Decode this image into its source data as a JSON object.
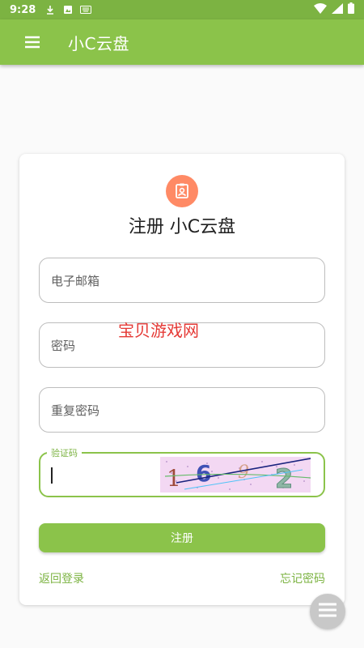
{
  "status_bar": {
    "time": "9:28",
    "icons": [
      "download-icon",
      "image-icon",
      "keyboard-icon",
      "wifi-icon",
      "signal-icon",
      "battery-icon"
    ]
  },
  "app_bar": {
    "title": "小C云盘",
    "menu_icon": "hamburger-menu-icon"
  },
  "form": {
    "avatar_icon": "badge-icon",
    "title": "注册 小C云盘",
    "email_placeholder": "电子邮箱",
    "password_placeholder": "密码",
    "repeat_password_placeholder": "重复密码",
    "captcha_label": "验证码",
    "captcha_value": "",
    "captcha_chars": [
      "1",
      "6",
      "9",
      "2"
    ],
    "register_label": "注册",
    "back_to_login": "返回登录",
    "forgot_password": "忘记密码"
  },
  "watermark": "宝贝游戏网",
  "colors": {
    "primary": "#8bc34a",
    "primary_dark": "#7cb342",
    "avatar_bg": "#ff8a65",
    "fab_bg": "#c8c8c8"
  }
}
